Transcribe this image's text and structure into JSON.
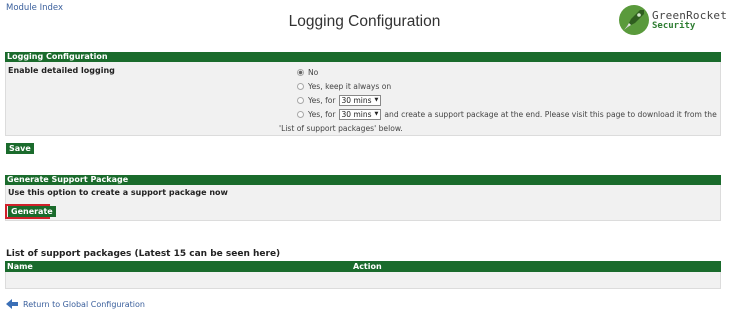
{
  "nav": {
    "module_index": "Module Index"
  },
  "page": {
    "title": "Logging Configuration"
  },
  "logo": {
    "line1": "GreenRocket",
    "line2": "Security",
    "icon": "rocket-icon"
  },
  "logging_section": {
    "header": "Logging Configuration",
    "label": "Enable detailed logging",
    "options": [
      {
        "label": "No",
        "selected": true
      },
      {
        "label": "Yes, keep it always on",
        "selected": false
      },
      {
        "prefix": "Yes, for",
        "select_value": "30 mins",
        "selected": false
      },
      {
        "prefix": "Yes, for",
        "select_value": "30 mins",
        "suffix": "and create a support package at the end. Please visit this page to download it from the",
        "selected": false
      }
    ],
    "continuation": "'List of support packages' below.",
    "save_label": "Save"
  },
  "support_section": {
    "header": "Generate Support Package",
    "description": "Use this option to create a support package now",
    "generate_label": "Generate"
  },
  "packages": {
    "title": "List of support packages (Latest 15 can be seen here)",
    "columns": [
      "Name",
      "Action"
    ],
    "rows": []
  },
  "footer": {
    "return_label": "Return to Global Configuration",
    "icon": "back-arrow-icon"
  },
  "colors": {
    "header_green": "#1a6b2c",
    "highlight_red": "#d0202a",
    "link_blue": "#3a5f9c"
  }
}
